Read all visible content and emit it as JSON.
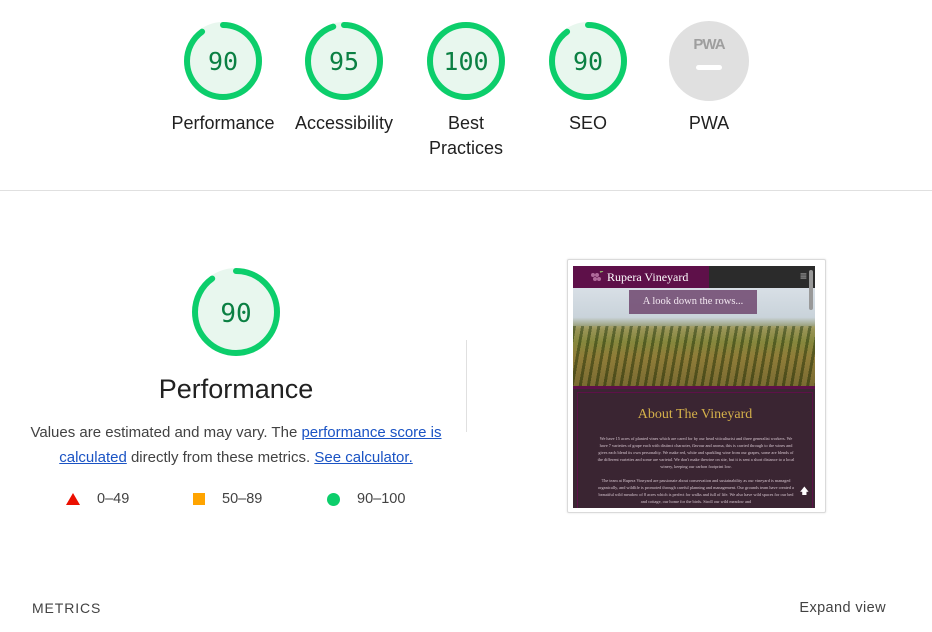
{
  "categories": [
    {
      "label": "Performance",
      "score": 90,
      "kind": "score"
    },
    {
      "label": "Accessibility",
      "score": 95,
      "kind": "score"
    },
    {
      "label_line1": "Best",
      "label_line2": "Practices",
      "score": 100,
      "kind": "score"
    },
    {
      "label": "SEO",
      "score": 90,
      "kind": "score"
    },
    {
      "label": "PWA",
      "badge_text": "PWA",
      "kind": "pwa"
    }
  ],
  "performance": {
    "score": 90,
    "title": "Performance",
    "desc_prefix": "Values are estimated and may vary. The ",
    "link_score": "performance score is calculated",
    "desc_middle": " directly from these metrics. ",
    "link_calc": "See calculator."
  },
  "legend": {
    "fail": "0–49",
    "average": "50–89",
    "pass": "90–100"
  },
  "screenshot": {
    "brand": "Rupera Vineyard",
    "menu_icon": "≡",
    "caption": "A look down the rows...",
    "heading": "About The Vineyard",
    "para1": "We have 15 acres of planted vines which are cared for by our head viticulturist and three generalist workers. We have 7 varieties of grape each with distinct character, flavour and aroma, this is carried through to the wines and gives each blend its own personality. We make red, white and sparkling wine from our grapes, some are blends of the different varieties and some are varietal. We don't make thewine on site, but it is sent a short distance to a local winery, keeping our carbon footprint low.",
    "para2": "The team at Rupera Vineyard are passionate about conservation and sustainability as our vineyard is managed organically, and wildlife is promoted through careful planning and management. Our grounds team have created a beautiful wild meadow of 8 acres which is perfect for walks and full of life. We also have wild spaces for our bed and cottage, our home for the birds. Stroll our wild meadow and",
    "up_arrow": "🡅"
  },
  "colors": {
    "pass": "#0cce6b",
    "pass_text": "#0b8043",
    "pass_fill": "#e8f7ee",
    "pwa_gray": "#e0e0e0",
    "fail": "#eb0f00",
    "average": "#ffa400",
    "link": "#1a53c4"
  },
  "footer": {
    "metrics": "METRICS",
    "expand": "Expand view"
  }
}
